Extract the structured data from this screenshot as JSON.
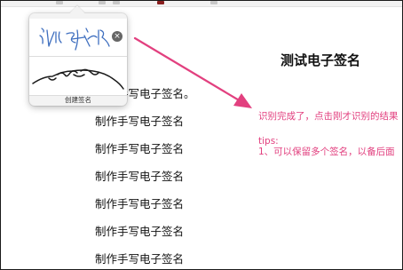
{
  "document": {
    "title": "测试电子签名",
    "lines": [
      "制作手写电子签名。",
      "制作手写电子签名",
      "制作手写电子签名",
      "制作手写电子签名",
      "制作手写电子签名",
      "制作手写电子签名",
      "制作手写电子签名"
    ]
  },
  "annotation": {
    "result_note": "识别完成了，点击刚才识别的结果",
    "tips_label": "tips:",
    "tip_1": "1、可以保留多个签名，以备后面"
  },
  "signature_popup": {
    "create_label": "创建签名",
    "delete_glyph": "×"
  },
  "colors": {
    "annotation": "#e2407f",
    "ink_blue": "#3f6fbf",
    "ink_black": "#1a1a1a"
  }
}
